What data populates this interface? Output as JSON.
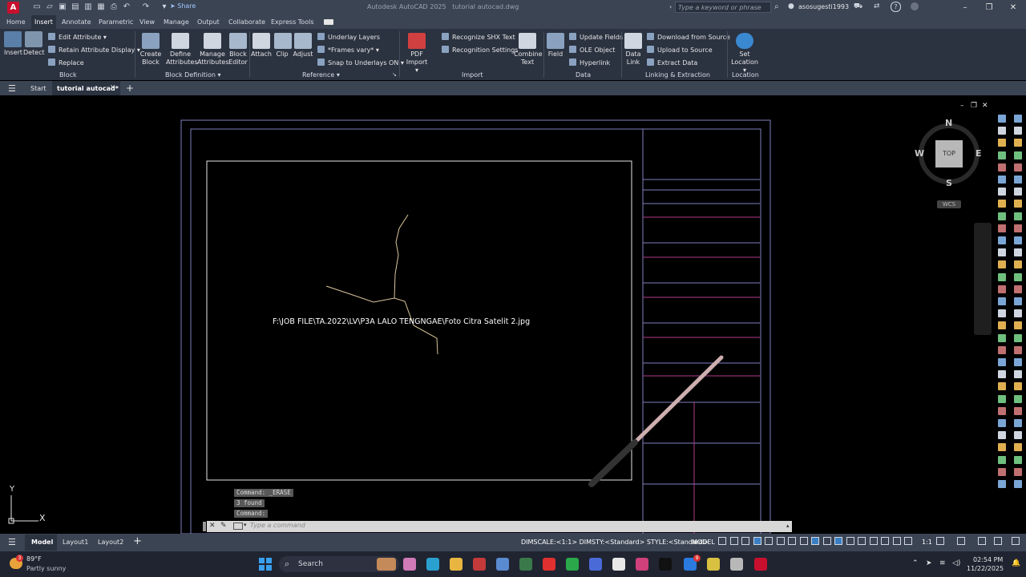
{
  "app": {
    "logo": "A",
    "title": "Autodesk AutoCAD 2025",
    "file": "tutorial autocad.dwg",
    "share_label": "Share",
    "search_placeholder": "Type a keyword or phrase",
    "user": "asosugesti1993"
  },
  "ribbon_tabs": [
    "Home",
    "Insert",
    "Annotate",
    "Parametric",
    "View",
    "Manage",
    "Output",
    "Collaborate",
    "Express Tools"
  ],
  "active_tab": "Insert",
  "ribbon": {
    "block": {
      "insert": "Insert",
      "detect": "Detect",
      "edit_attribute": "Edit Attribute",
      "retain_attribute_display": "Retain Attribute Display",
      "replace": "Replace",
      "group": "Block"
    },
    "block_definition": {
      "create": [
        "Create",
        "Block"
      ],
      "define": [
        "Define",
        "Attributes"
      ],
      "manage": [
        "Manage",
        "Attributes"
      ],
      "editor": [
        "Block",
        "Editor"
      ],
      "group": "Block Definition"
    },
    "reference": {
      "attach": "Attach",
      "clip": "Clip",
      "adjust": "Adjust",
      "underlay_layers": "Underlay Layers",
      "frames": "*Frames vary*",
      "snap": "Snap to Underlays ON",
      "group": "Reference"
    },
    "import": {
      "pdf": [
        "PDF",
        "Import"
      ],
      "recognize_shx": "Recognize SHX Text",
      "recognition_settings": "Recognition Settings",
      "combine": [
        "Combine",
        "Text"
      ],
      "group": "Import"
    },
    "data": {
      "field": "Field",
      "update_fields": "Update Fields",
      "ole_object": "OLE Object",
      "hyperlink": "Hyperlink",
      "group": "Data"
    },
    "linking": {
      "data_link": [
        "Data",
        "Link"
      ],
      "download": "Download from Source",
      "upload": "Upload to Source",
      "extract": "Extract  Data",
      "group": "Linking & Extraction"
    },
    "location": {
      "set_location": [
        "Set",
        "Location"
      ],
      "group": "Location"
    }
  },
  "doc_tabs": {
    "start": "Start",
    "active": "tutorial autocad*"
  },
  "drawing": {
    "image_path": "F:\\JOB FILE\\TA.2022\\LV\\P3A LALO TENGNGAE\\Foto Citra Satelit 2.jpg"
  },
  "viewcube": {
    "n": "N",
    "s": "S",
    "e": "E",
    "w": "W",
    "top": "TOP",
    "wcs": "WCS"
  },
  "ucs": {
    "x": "X",
    "y": "Y"
  },
  "command": {
    "history": [
      "Command: _ERASE",
      "3 found",
      "Command:"
    ],
    "placeholder": "Type a command"
  },
  "layout_tabs": [
    "Model",
    "Layout1",
    "Layout2"
  ],
  "status": {
    "props": "DIMSCALE:<1:1> DIMSTY:<Standard> STYLE:<Standard>",
    "model": "MODEL",
    "scale": "1:1"
  },
  "taskbar": {
    "temp": "89°F",
    "weather": "Partly sunny",
    "search": "Search",
    "time": "02:54 PM",
    "date": "11/22/2025",
    "badge_weather": "3",
    "badge_app": "9"
  },
  "colors": {
    "chrome": "#3b4453",
    "ribbon": "#2b3240",
    "frame": "#8080c0",
    "magenta": "#b03a8a",
    "contour": "#d9c79a"
  }
}
